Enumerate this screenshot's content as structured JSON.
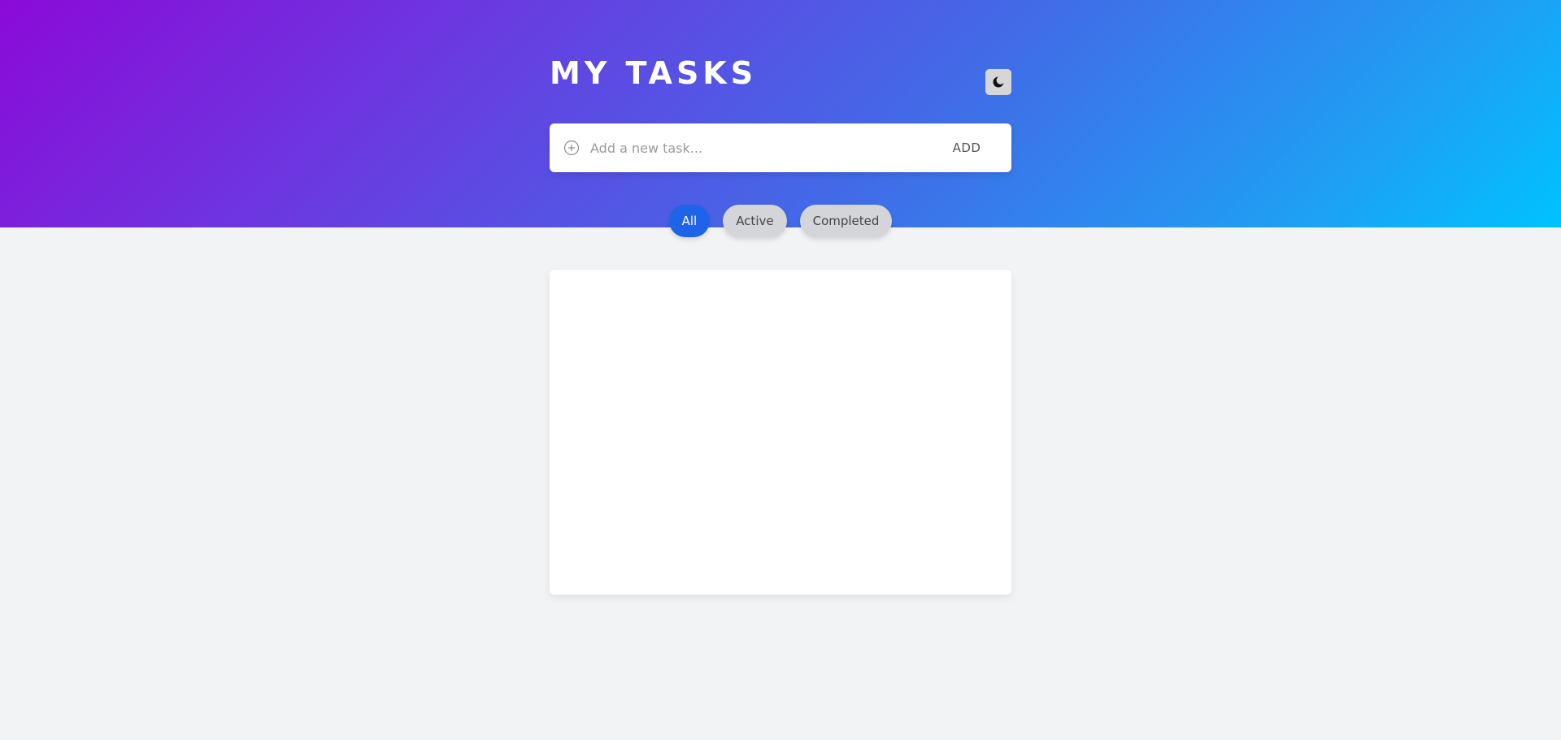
{
  "header": {
    "title": "MY TASKS",
    "theme_toggle_icon": "moon-icon"
  },
  "add_task": {
    "icon": "plus-circle-icon",
    "placeholder": "Add a new task...",
    "value": "",
    "button_label": "ADD"
  },
  "filters": {
    "all_label": "All",
    "active_label": "Active",
    "completed_label": "Completed",
    "selected": "All"
  },
  "tasks": [],
  "colors": {
    "gradient_start": "#8b0ad8",
    "gradient_end": "#00c2ff",
    "accent": "#1f63e8",
    "background": "#f2f3f5"
  }
}
